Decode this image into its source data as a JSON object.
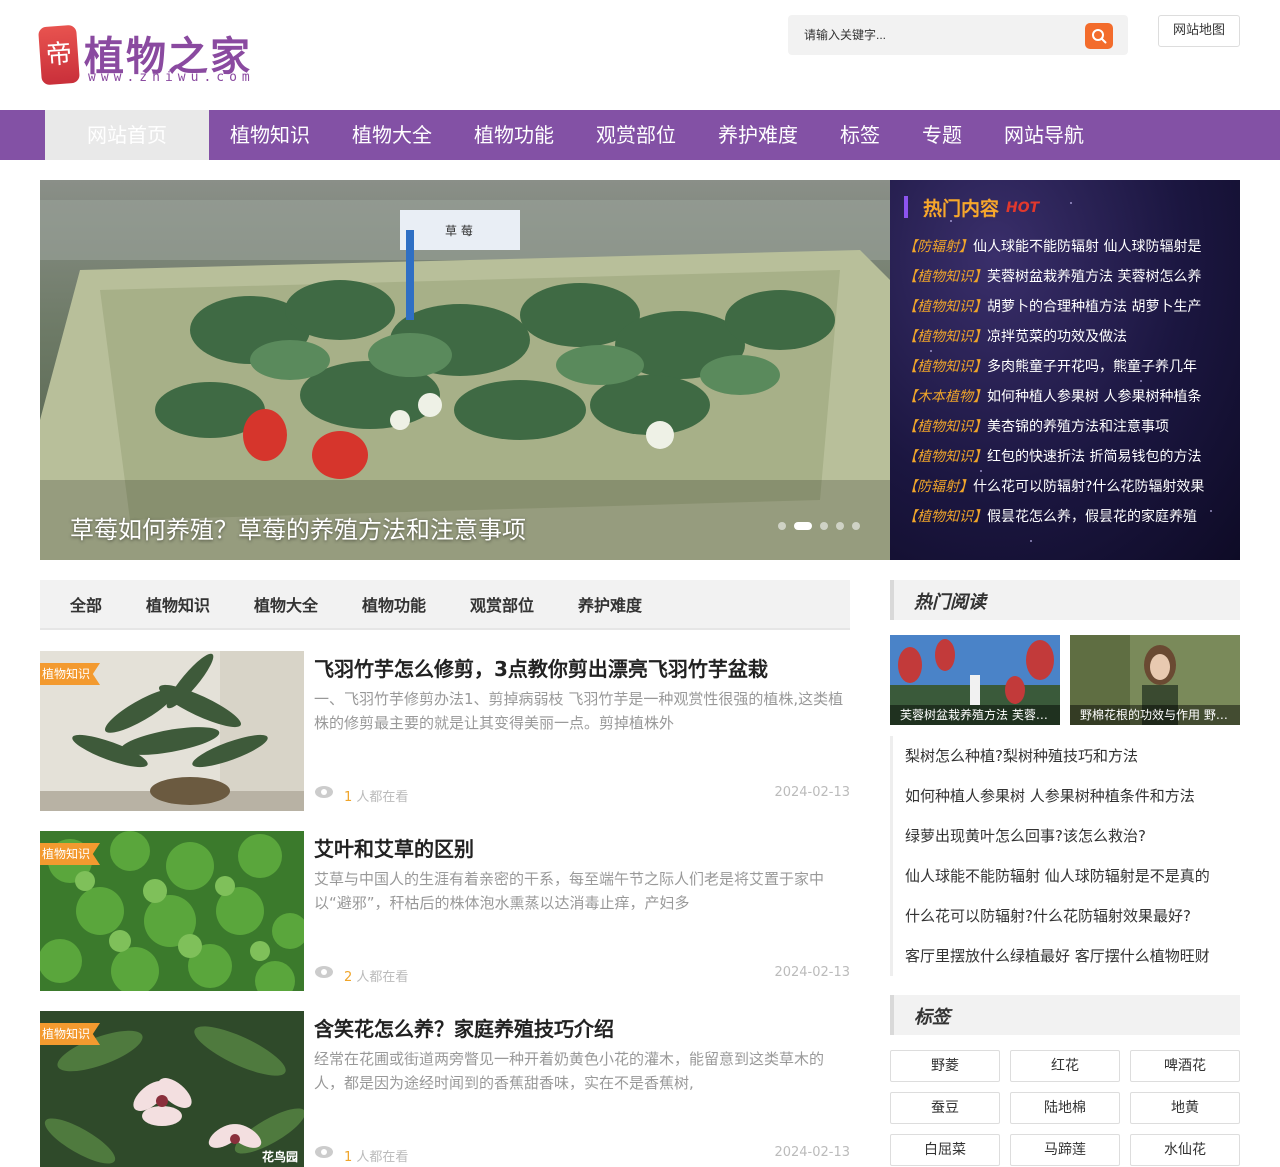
{
  "header": {
    "logo_mark": "帝",
    "logo_text": "植物之家",
    "logo_url": "www.zhiwu.com",
    "search_placeholder": "请输入关键字...",
    "sitemap_label": "网站地图"
  },
  "nav": {
    "items": [
      "网站首页",
      "植物知识",
      "植物大全",
      "植物功能",
      "观赏部位",
      "养护难度",
      "标签",
      "专题",
      "网站导航"
    ],
    "active_index": 0
  },
  "hero": {
    "title": "草莓如何养殖？草莓的养殖方法和注意事项",
    "sign_text": "草 莓",
    "slide_count": 5,
    "active_slide": 1
  },
  "hot": {
    "title": "热门内容",
    "tag": "HOT",
    "items": [
      {
        "cat": "【防辐射】",
        "text": "仙人球能不能防辐射 仙人球防辐射是"
      },
      {
        "cat": "【植物知识】",
        "text": "芙蓉树盆栽养殖方法 芙蓉树怎么养"
      },
      {
        "cat": "【植物知识】",
        "text": "胡萝卜的合理种植方法 胡萝卜生产"
      },
      {
        "cat": "【植物知识】",
        "text": "凉拌苋菜的功效及做法"
      },
      {
        "cat": "【植物知识】",
        "text": "多肉熊童子开花吗，熊童子养几年"
      },
      {
        "cat": "【木本植物】",
        "text": "如何种植人参果树 人参果树种植条"
      },
      {
        "cat": "【植物知识】",
        "text": "美杏锦的养殖方法和注意事项"
      },
      {
        "cat": "【植物知识】",
        "text": "红包的快速折法 折简易钱包的方法"
      },
      {
        "cat": "【防辐射】",
        "text": "什么花可以防辐射?什么花防辐射效果"
      },
      {
        "cat": "【植物知识】",
        "text": "假昙花怎么养，假昙花的家庭养殖"
      }
    ]
  },
  "filter": {
    "tabs": [
      "全部",
      "植物知识",
      "植物大全",
      "植物功能",
      "观赏部位",
      "养护难度"
    ]
  },
  "articles": [
    {
      "badge": "植物知识",
      "title": "飞羽竹芋怎么修剪，3点教你剪出漂亮飞羽竹芋盆栽",
      "desc": "一、飞羽竹芋修剪办法1、剪掉病弱枝 飞羽竹芋是一种观赏性很强的植株,这类植株的修剪最主要的就是让其变得美丽一点。剪掉植株外",
      "views": "1",
      "views_suffix": "人都在看",
      "date": "2024-02-13"
    },
    {
      "badge": "植物知识",
      "title": "艾叶和艾草的区别",
      "desc": "艾草与中国人的生涯有着亲密的干系，每至端午节之际人们老是将艾置于家中以“避邪”，秆枯后的株体泡水熏蒸以达消毒止痒，产妇多",
      "views": "2",
      "views_suffix": "人都在看",
      "date": "2024-02-13"
    },
    {
      "badge": "植物知识",
      "title": "含笑花怎么养？家庭养殖技巧介绍",
      "desc": "经常在花圃或街道两旁瞥见一种开着奶黄色小花的灌木，能留意到这类草木的人，都是因为途经时闻到的香蕉甜香味，实在不是香蕉树,",
      "views": "1",
      "views_suffix": "人都在看",
      "date": "2024-02-13",
      "watermark": "花鸟园"
    }
  ],
  "sidebar": {
    "hot_read_title": "热门阅读",
    "pics": [
      {
        "caption": "芙蓉树盆栽养殖方法 芙蓉树怎么养"
      },
      {
        "caption": "野棉花根的功效与作用 野棉花的作用"
      }
    ],
    "links": [
      "梨树怎么种植?梨树种殖技巧和方法",
      "如何种植人参果树 人参果树种植条件和方法",
      "绿萝出现黄叶怎么回事?该怎么救治?",
      "仙人球能不能防辐射 仙人球防辐射是不是真的",
      "什么花可以防辐射?什么花防辐射效果最好?",
      "客厅里摆放什么绿植最好 客厅摆什么植物旺财"
    ],
    "tags_title": "标签",
    "tags": [
      "野菱",
      "红花",
      "啤酒花",
      "蚕豆",
      "陆地棉",
      "地黄",
      "白屈菜",
      "马蹄莲",
      "水仙花"
    ]
  },
  "colors": {
    "nav": "#8351a5",
    "accent_orange": "#f36c2c",
    "hot_cat": "#f0a52a",
    "badge": "#f39a2f"
  }
}
